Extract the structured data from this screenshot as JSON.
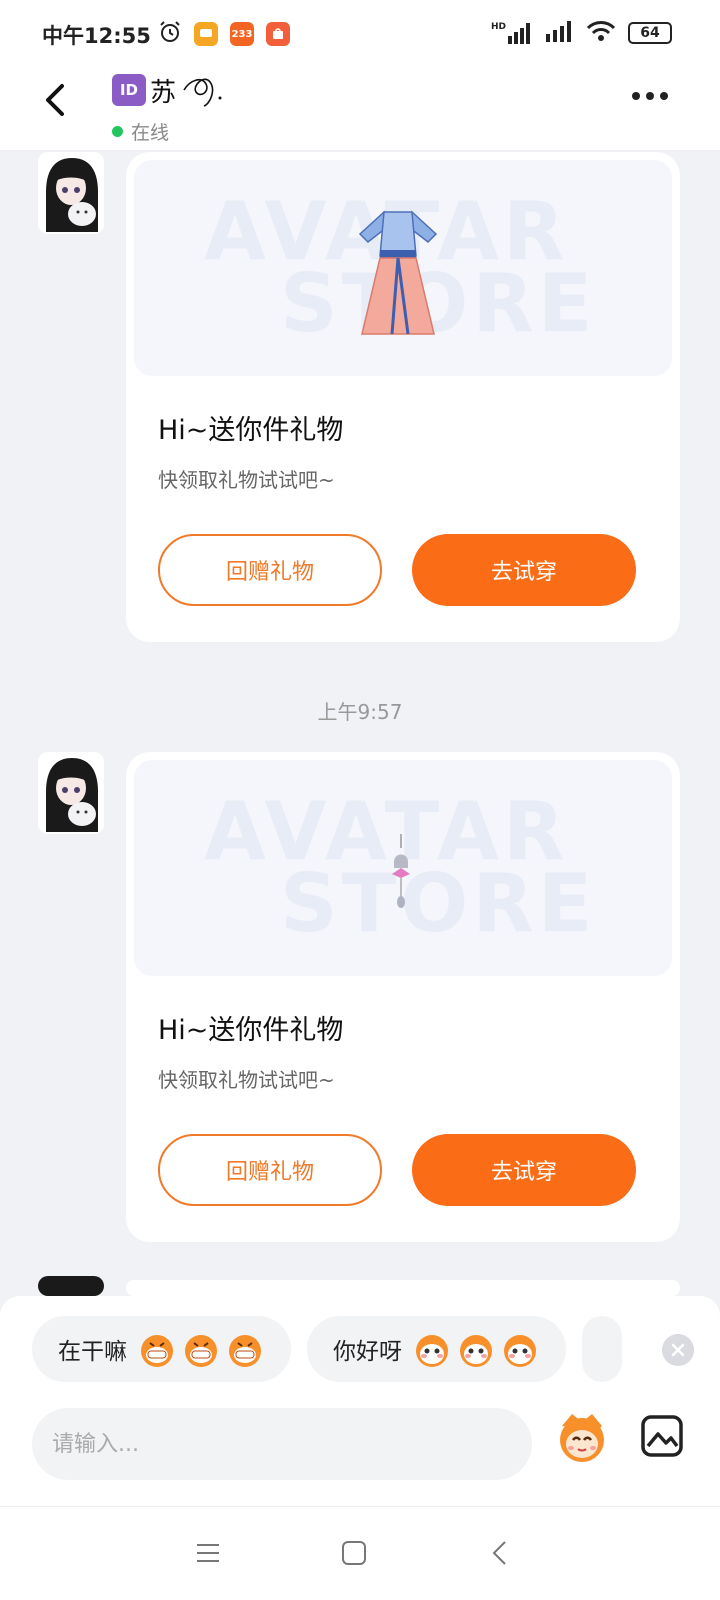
{
  "status_bar": {
    "time": "中午12:55",
    "app_badge_233": "233",
    "battery": "64",
    "network": "HD"
  },
  "header": {
    "id_badge": "ID",
    "contact_name": "苏",
    "online_status": "在线"
  },
  "messages": [
    {
      "watermark_line1": "AVATAR",
      "watermark_line2": "STORE",
      "title": "Hi~送你件礼物",
      "subtitle": "快领取礼物试试吧~",
      "return_gift_label": "回赠礼物",
      "try_on_label": "去试穿",
      "item_icon": "hanfu-dress-icon"
    },
    {
      "watermark_line1": "AVATAR",
      "watermark_line2": "STORE",
      "title": "Hi~送你件礼物",
      "subtitle": "快领取礼物试试吧~",
      "return_gift_label": "回赠礼物",
      "try_on_label": "去试穿",
      "item_icon": "bell-charm-icon"
    }
  ],
  "time_divider": "上午9:57",
  "quick_replies": [
    {
      "text": "在干嘛",
      "emoji": "grinning-mascot-icon",
      "emoji_count": 3
    },
    {
      "text": "你好呀",
      "emoji": "blushing-mascot-icon",
      "emoji_count": 3
    }
  ],
  "input": {
    "placeholder": "请输入..."
  },
  "colors": {
    "accent": "#fb6c16",
    "accent_outline": "#f07a2a",
    "online": "#22c55e",
    "id_badge": "#8b5cc6"
  }
}
